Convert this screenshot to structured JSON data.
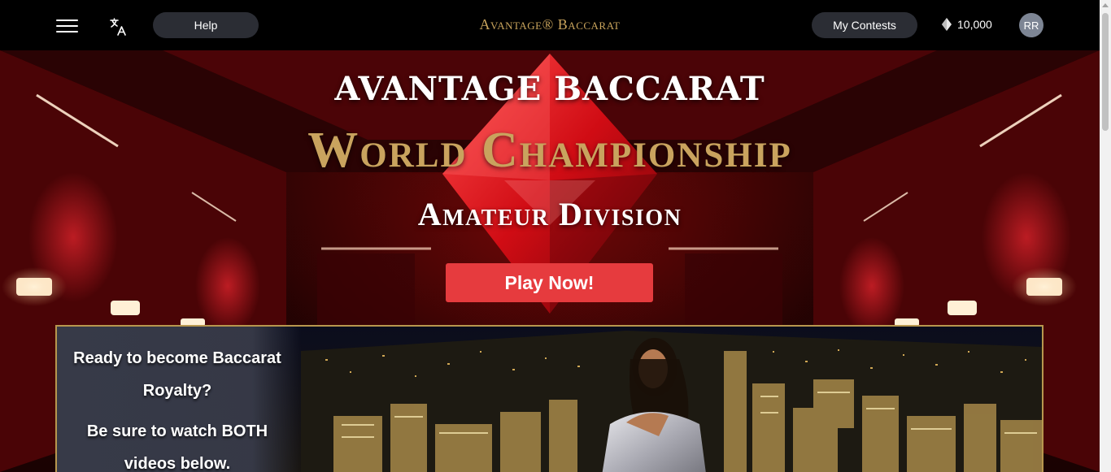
{
  "header": {
    "help_label": "Help",
    "brand": "Avantage® Baccarat",
    "my_contests_label": "My Contests",
    "balance": "10,000",
    "avatar_initials": "RR"
  },
  "hero": {
    "title_line1": "AVANTAGE BACCARAT",
    "title_line2": "World Championship",
    "title_line3": "Amateur Division",
    "play_button": "Play Now!"
  },
  "promo": {
    "line1": "Ready to become Baccarat",
    "line2": "Royalty?",
    "line3": "Be sure to watch BOTH",
    "line4": "videos below."
  },
  "colors": {
    "accent_gold": "#c9a35e",
    "play_red": "#e63b3e",
    "pill_bg": "#2b2d34"
  },
  "icons": {
    "menu": "hamburger-icon",
    "translate": "translate-icon",
    "diamond": "diamond-icon"
  }
}
